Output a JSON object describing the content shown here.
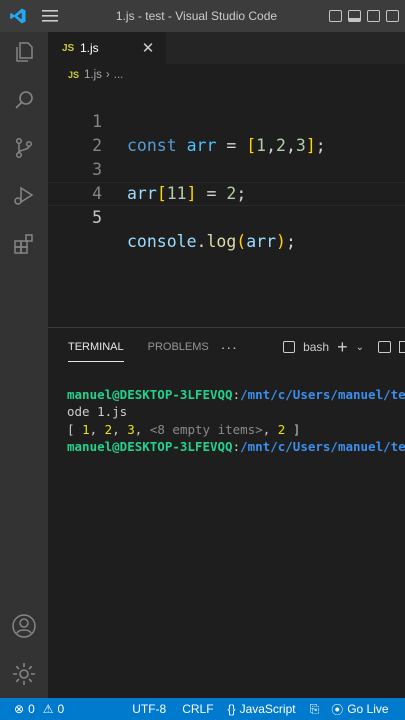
{
  "titlebar": {
    "title": "1.js - test - Visual Studio Code"
  },
  "activitybar": {
    "items": [
      "explorer-icon",
      "search-icon",
      "source-control-icon",
      "run-debug-icon",
      "extensions-icon"
    ],
    "bottom": [
      "account-icon",
      "settings-gear-icon"
    ]
  },
  "tab": {
    "badge": "JS",
    "label": "1.js"
  },
  "breadcrumb": {
    "badge": "JS",
    "file": "1.js",
    "separator": "›",
    "more": "..."
  },
  "editor": {
    "line_numbers": [
      "1",
      "2",
      "3",
      "4",
      "5"
    ],
    "active_line": "5"
  },
  "panel": {
    "tab_terminal": "TERMINAL",
    "tab_problems": "PROBLEMS",
    "more": "···",
    "shell": "bash",
    "plus": "+"
  },
  "terminal": {
    "user_host": "manuel@DESKTOP-3LFEVQQ",
    "colon": ":",
    "path": "/mnt/c/Users/manuel/te",
    "line2": "ode 1.js",
    "output": {
      "open": "[ ",
      "n1": "1",
      "sep": ", ",
      "n2": "2",
      "n3": "3",
      "empty": "<8 empty items>",
      "n4": "2",
      "close": " ]"
    },
    "user_host2": "manuel@DESKTOP-3LFEVQQ",
    "path2": "/mnt/c/Users/manuel/te"
  },
  "statusbar": {
    "errors": "0",
    "warnings": "0",
    "encoding": "UTF-8",
    "eol": "CRLF",
    "language": "JavaScript",
    "golive": "Go Live"
  },
  "colors": {
    "accent": "#007acc",
    "activitybar": "#333333",
    "titlebar": "#3c3c3c"
  }
}
